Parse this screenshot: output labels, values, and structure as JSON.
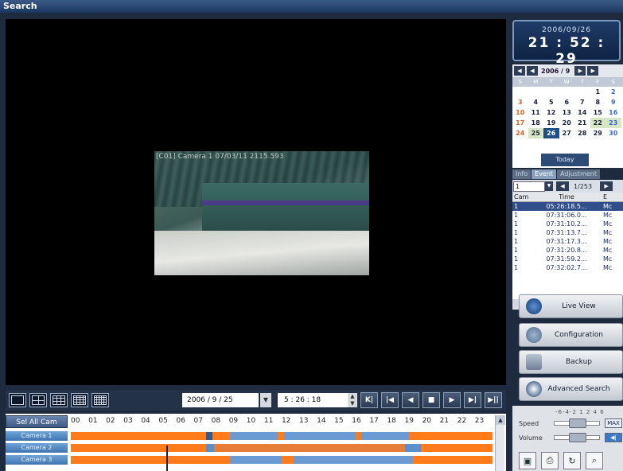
{
  "window": {
    "title": "Search"
  },
  "video": {
    "osd": "[C01] Camera 1 07/03/11 2115.593"
  },
  "toolbar": {
    "date": "2006 /  9 / 25",
    "date_drop": "▼",
    "time": "5  :  26  :  18",
    "time_spin_up": "▲",
    "time_spin_down": "▼",
    "layouts": [
      "layout-1x1-icon",
      "layout-2x2-icon",
      "layout-3x3-icon",
      "layout-4x4-icon",
      "layout-5x5-icon"
    ],
    "buttons": [
      {
        "name": "jump-start-button",
        "icon": "K|"
      },
      {
        "name": "prev-frame-button",
        "icon": "|◀"
      },
      {
        "name": "reverse-play-button",
        "icon": "◀"
      },
      {
        "name": "stop-button",
        "icon": "■"
      },
      {
        "name": "play-button",
        "icon": "▶"
      },
      {
        "name": "next-frame-button",
        "icon": "▶|"
      },
      {
        "name": "pause-play-button",
        "icon": "▶||"
      }
    ]
  },
  "timeline": {
    "select_all": "Sel All Cam",
    "hours": [
      "00",
      "01",
      "02",
      "03",
      "04",
      "05",
      "06",
      "07",
      "08",
      "09",
      "10",
      "11",
      "12",
      "13",
      "14",
      "15",
      "16",
      "17",
      "18",
      "19",
      "20",
      "21",
      "22",
      "23"
    ],
    "cameras": [
      "Camera 1",
      "Camera 2",
      "Camera 3"
    ]
  },
  "clock": {
    "date": "2006/09/26",
    "time": "21 : 52 : 29"
  },
  "calendar": {
    "month": "2006 / 9",
    "dow": [
      "S",
      "M",
      "T",
      "W",
      "T",
      "F",
      "S"
    ],
    "days": [
      "",
      "",
      "",
      "",
      "",
      "1",
      "2",
      "3",
      "4",
      "5",
      "6",
      "7",
      "8",
      "9",
      "10",
      "11",
      "12",
      "13",
      "14",
      "15",
      "16",
      "17",
      "18",
      "19",
      "20",
      "21",
      "22",
      "23",
      "24",
      "25",
      "26",
      "27",
      "28",
      "29",
      "30"
    ],
    "today": "Today"
  },
  "tabs": [
    "Info",
    "Event",
    "Adjustment"
  ],
  "events": {
    "cam_select": "1",
    "page": "1/253",
    "columns": [
      "Cam",
      "Time",
      "E"
    ],
    "rows": [
      {
        "cam": "1",
        "time": "05:26:18.5...",
        "ev": "Mc"
      },
      {
        "cam": "1",
        "time": "07:31:06.0...",
        "ev": "Mc"
      },
      {
        "cam": "1",
        "time": "07:31:10.2...",
        "ev": "Mc"
      },
      {
        "cam": "1",
        "time": "07:31:13.7...",
        "ev": "Mc"
      },
      {
        "cam": "1",
        "time": "07:31:17.3...",
        "ev": "Mc"
      },
      {
        "cam": "1",
        "time": "07:31:20.8...",
        "ev": "Mc"
      },
      {
        "cam": "1",
        "time": "07:31:59.2...",
        "ev": "Mc"
      },
      {
        "cam": "1",
        "time": "07:32:02.7...",
        "ev": "Mc"
      }
    ]
  },
  "side_buttons": {
    "live_view": "Live View",
    "configuration": "Configuration",
    "backup": "Backup",
    "advanced_search": "Advanced Search"
  },
  "controls": {
    "scale": "-6-4-2 1 2 4 6",
    "speed": "Speed",
    "volume": "Volume",
    "max": "MAX",
    "mute": "◀|"
  }
}
